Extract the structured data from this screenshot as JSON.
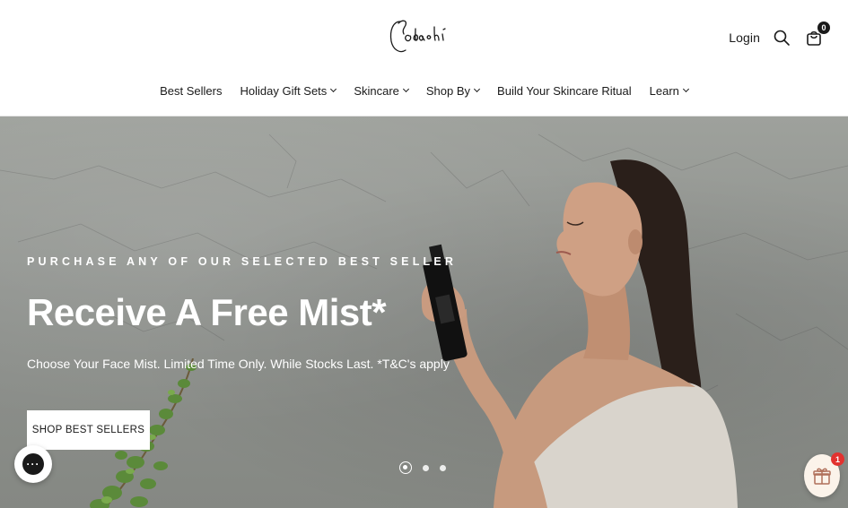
{
  "brand": {
    "logo_text": "Sodashi"
  },
  "header": {
    "login_label": "Login",
    "search_icon": "search-icon",
    "cart_icon": "cart-icon",
    "cart_count": "0"
  },
  "nav": {
    "items": [
      {
        "label": "Best Sellers",
        "has_dropdown": false
      },
      {
        "label": "Holiday Gift Sets",
        "has_dropdown": true
      },
      {
        "label": "Skincare",
        "has_dropdown": true
      },
      {
        "label": "Shop By",
        "has_dropdown": true
      },
      {
        "label": "Build Your Skincare Ritual",
        "has_dropdown": false
      },
      {
        "label": "Learn",
        "has_dropdown": true
      }
    ]
  },
  "hero": {
    "eyebrow": "PURCHASE ANY OF OUR SELECTED BEST SELLER",
    "title": "Receive A Free Mist*",
    "subtitle": "Choose Your Face Mist. Limited Time Only. While Stocks Last. *T&C's apply",
    "cta_label": "SHOP BEST SELLERS",
    "slides": {
      "count": 3,
      "active_index": 0
    }
  },
  "widgets": {
    "chat_icon": "chat-icon",
    "chat_glyph": "···",
    "gift_icon": "gift-icon",
    "gift_badge_count": "1"
  },
  "colors": {
    "text": "#1a1a1a",
    "hero_text": "#ffffff",
    "badge_red": "#e2322f",
    "gift_bg": "#fbf3ea"
  }
}
